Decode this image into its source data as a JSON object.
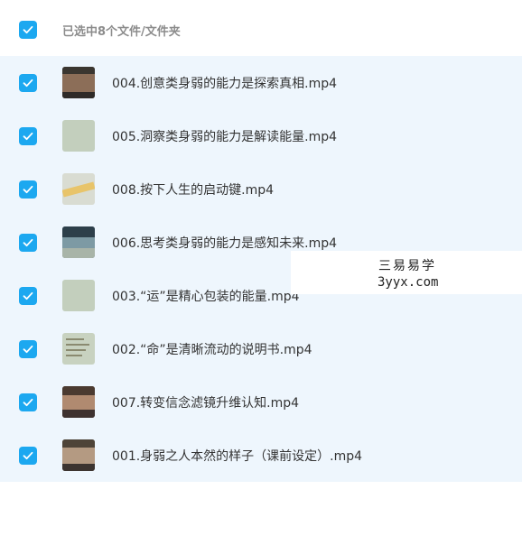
{
  "header": {
    "select_all_checked": true,
    "selection_label": "已选中8个文件/文件夹"
  },
  "files": [
    {
      "name": "004.创意类身弱的能力是探索真相.mp4",
      "checked": true,
      "thumb_icon": "video-thumbnail-icon"
    },
    {
      "name": "005.洞察类身弱的能力是解读能量.mp4",
      "checked": true,
      "thumb_icon": "video-thumbnail-icon"
    },
    {
      "name": "008.按下人生的启动键.mp4",
      "checked": true,
      "thumb_icon": "video-thumbnail-icon"
    },
    {
      "name": "006.思考类身弱的能力是感知未来.mp4",
      "checked": true,
      "thumb_icon": "video-thumbnail-icon"
    },
    {
      "name": "003.“运”是精心包装的能量.mp4",
      "checked": true,
      "thumb_icon": "video-thumbnail-icon"
    },
    {
      "name": "002.“命”是清晰流动的说明书.mp4",
      "checked": true,
      "thumb_icon": "video-thumbnail-icon"
    },
    {
      "name": "007.转变信念滤镜升维认知.mp4",
      "checked": true,
      "thumb_icon": "video-thumbnail-icon"
    },
    {
      "name": "001.身弱之人本然的样子（课前设定）.mp4",
      "checked": true,
      "thumb_icon": "video-thumbnail-icon"
    }
  ],
  "watermark": {
    "line1": "三易易学",
    "line2": "3yyx.com"
  },
  "colors": {
    "checkbox": "#1ca8f0",
    "list_background": "#eef6fd",
    "header_text": "#8c8c8c",
    "file_text": "#333333"
  }
}
